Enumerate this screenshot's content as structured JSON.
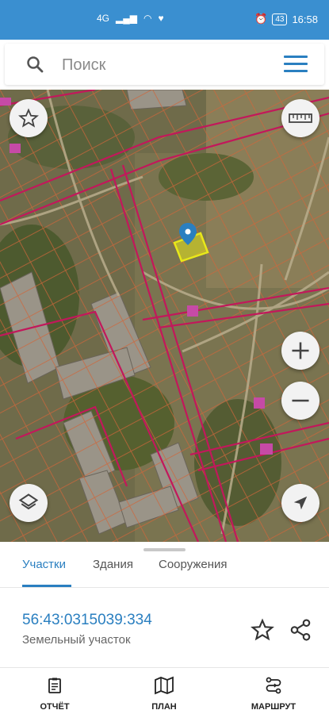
{
  "status_bar": {
    "network": "4G",
    "battery": "43",
    "time": "16:58"
  },
  "search": {
    "placeholder": "Поиск"
  },
  "map": {
    "buttons": [
      "favorites",
      "ruler",
      "zoom-in",
      "zoom-out",
      "layers",
      "my-location"
    ]
  },
  "sheet": {
    "tabs": [
      {
        "label": "Участки",
        "active": true
      },
      {
        "label": "Здания",
        "active": false
      },
      {
        "label": "Сооружения",
        "active": false
      }
    ],
    "parcel": {
      "cadastral_number": "56:43:0315039:334",
      "type": "Земельный участок"
    }
  },
  "bottom_nav": [
    {
      "label": "ОТЧЁТ",
      "icon": "report-icon"
    },
    {
      "label": "ПЛАН",
      "icon": "map-plan-icon"
    },
    {
      "label": "МАРШРУТ",
      "icon": "route-icon"
    }
  ],
  "colors": {
    "accent": "#2a7fc0",
    "status_bar": "#3a8fd0",
    "boundary": "#c2185b",
    "selected_parcel": "#e8e81a"
  }
}
